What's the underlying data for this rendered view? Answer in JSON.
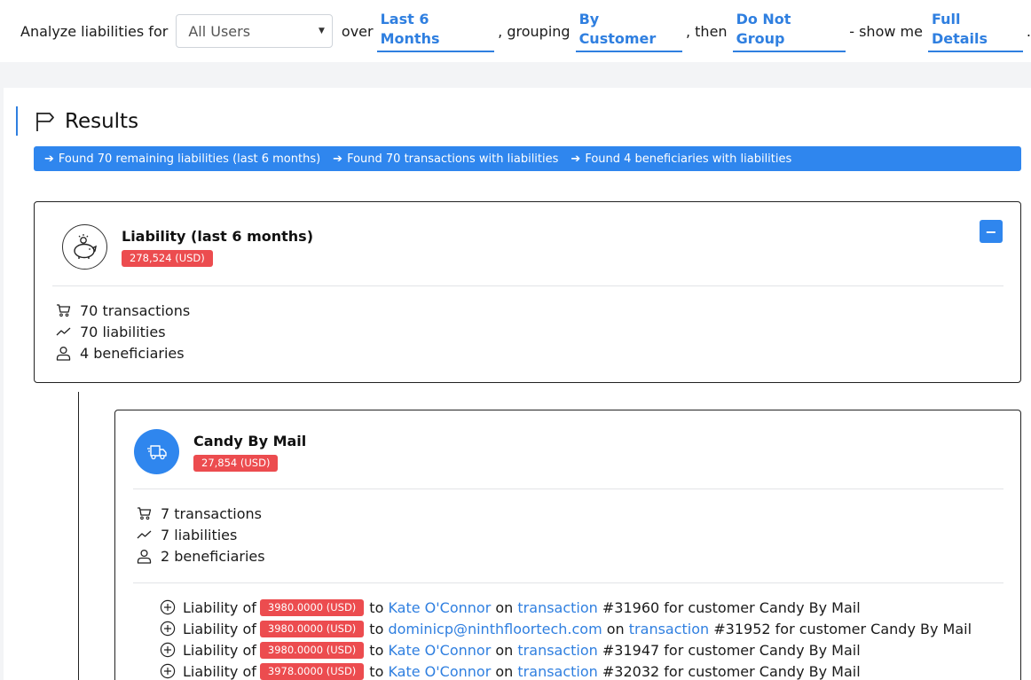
{
  "query": {
    "prefix": "Analyze liabilities for",
    "user_select": "All Users",
    "over": "over",
    "period": "Last 6 Months",
    "grouping_text": ", grouping",
    "grouping": "By Customer",
    "then_text": ", then",
    "then_group": "Do Not Group",
    "show_text": "- show me",
    "detail": "Full Details",
    "end": "."
  },
  "results": {
    "title": "Results",
    "summary": [
      "Found 70 remaining liabilities (last 6 months)",
      "Found 70 transactions with liabilities",
      "Found 4 beneficiaries with liabilities"
    ]
  },
  "main_card": {
    "title": "Liability (last 6 months)",
    "amount": "278,524 (USD)",
    "collapse": "−",
    "stats": [
      "70 transactions",
      "70 liabilities",
      "4 beneficiaries"
    ]
  },
  "sub_card": {
    "title": "Candy By Mail",
    "amount": "27,854 (USD)",
    "stats": [
      "7 transactions",
      "7 liabilities",
      "2 beneficiaries"
    ],
    "liabilities": [
      {
        "prefix": "Liability of",
        "amount": "3980.0000 (USD)",
        "to": "to",
        "beneficiary": "Kate O'Connor",
        "on": "on",
        "tx_link": "transaction",
        "tx_id": "#31960 for customer Candy By Mail"
      },
      {
        "prefix": "Liability of",
        "amount": "3980.0000 (USD)",
        "to": "to",
        "beneficiary": "dominicp@ninthfloortech.com",
        "on": "on",
        "tx_link": "transaction",
        "tx_id": "#31952 for customer Candy By Mail"
      },
      {
        "prefix": "Liability of",
        "amount": "3980.0000 (USD)",
        "to": "to",
        "beneficiary": "Kate O'Connor",
        "on": "on",
        "tx_link": "transaction",
        "tx_id": "#31947 for customer Candy By Mail"
      },
      {
        "prefix": "Liability of",
        "amount": "3978.0000 (USD)",
        "to": "to",
        "beneficiary": "Kate O'Connor",
        "on": "on",
        "tx_link": "transaction",
        "tx_id": "#32032 for customer Candy By Mail"
      }
    ]
  },
  "colors": {
    "accent": "#2f86ee",
    "badge": "#ec4c4f"
  }
}
